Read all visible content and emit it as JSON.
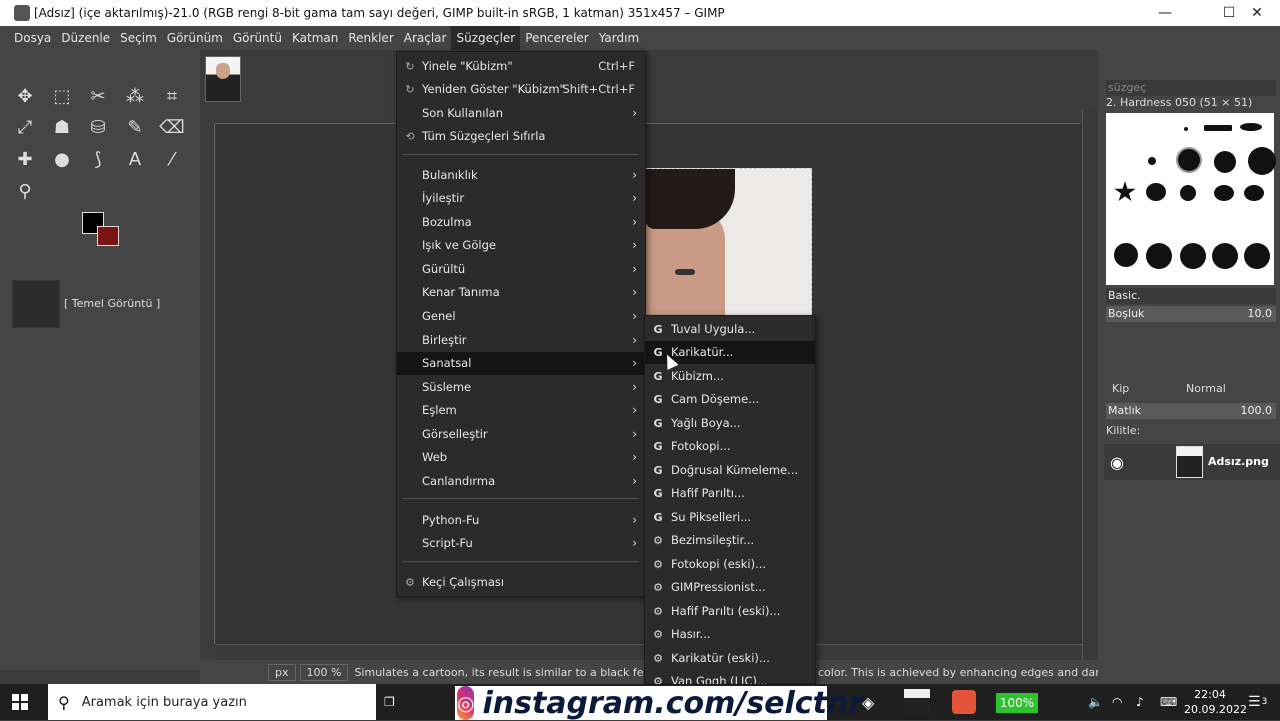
{
  "window": {
    "title": "[Adsız] (içe aktarılmış)-21.0 (RGB rengi 8-bit gama tam sayı değeri, GIMP built-in sRGB, 1 katman) 351x457 – GIMP",
    "minimize": "—",
    "maximize": "☐",
    "close": "✕"
  },
  "menubar": [
    "Dosya",
    "Düzenle",
    "Seçim",
    "Görünüm",
    "Görüntü",
    "Katman",
    "Renkler",
    "Araçlar",
    "Süzgeçler",
    "Pencereler",
    "Yardım"
  ],
  "menubar_active": "Süzgeçler",
  "filters_menu": {
    "items": [
      {
        "label": "Yinele \"Kübizm\"",
        "shortcut": "Ctrl+F",
        "icon": "↻"
      },
      {
        "label": "Yeniden Göster \"Kübizm\"",
        "shortcut": "Shift+Ctrl+F",
        "icon": "↻"
      },
      {
        "label": "Son Kullanılan",
        "arrow": "›"
      },
      {
        "label": "Tüm Süzgeçleri Sıfırla",
        "icon": "⟲"
      },
      {
        "label": "Bulanıklık",
        "arrow": "›"
      },
      {
        "label": "İyileştir",
        "arrow": "›"
      },
      {
        "label": "Bozulma",
        "arrow": "›"
      },
      {
        "label": "Işık ve Gölge",
        "arrow": "›"
      },
      {
        "label": "Gürültü",
        "arrow": "›"
      },
      {
        "label": "Kenar Tanıma",
        "arrow": "›"
      },
      {
        "label": "Genel",
        "arrow": "›"
      },
      {
        "label": "Birleştir",
        "arrow": "›"
      },
      {
        "label": "Sanatsal",
        "arrow": "›"
      },
      {
        "label": "Süsleme",
        "arrow": "›"
      },
      {
        "label": "Eşlem",
        "arrow": "›"
      },
      {
        "label": "Görselleştir",
        "arrow": "›"
      },
      {
        "label": "Web",
        "arrow": "›"
      },
      {
        "label": "Canlandırma",
        "arrow": "›"
      },
      {
        "label": "Python-Fu",
        "arrow": "›"
      },
      {
        "label": "Script-Fu",
        "arrow": "›"
      },
      {
        "label": "Keçi Çalışması",
        "icon": "⚙"
      }
    ]
  },
  "artistic_submenu": {
    "items": [
      {
        "label": "Tuval Uygula...",
        "icon": "G"
      },
      {
        "label": "Karikatür...",
        "icon": "G"
      },
      {
        "label": "Kübizm...",
        "icon": "G"
      },
      {
        "label": "Cam Döşeme...",
        "icon": "G"
      },
      {
        "label": "Yağlı Boya...",
        "icon": "G"
      },
      {
        "label": "Fotokopi...",
        "icon": "G"
      },
      {
        "label": "Doğrusal Kümeleme...",
        "icon": "G"
      },
      {
        "label": "Hafif Parıltı...",
        "icon": "G"
      },
      {
        "label": "Su Pikselleri...",
        "icon": "G"
      },
      {
        "label": "Bezimsileştir...",
        "icon": "⚙"
      },
      {
        "label": "Fotokopi (eski)...",
        "icon": "⚙"
      },
      {
        "label": "GIMPressionist...",
        "icon": "⚙"
      },
      {
        "label": "Hafif Parıltı (eski)...",
        "icon": "⚙"
      },
      {
        "label": "Hasır...",
        "icon": "⚙"
      },
      {
        "label": "Karikatür (eski)...",
        "icon": "⚙"
      },
      {
        "label": "Van Gogh (LIC)...",
        "icon": "⚙"
      }
    ]
  },
  "left_dock": {
    "layer_label": "[ Temel Görüntü ]"
  },
  "right_dock": {
    "filter_placeholder": "süzgeç",
    "brush_name": "2. Hardness 050 (51 × 51)",
    "preset": "Basic.",
    "spacing_label": "Boşluk",
    "spacing_value": "10.0",
    "mode_label": "Kip",
    "mode_value": "Normal",
    "opacity_label": "Matlık",
    "opacity_value": "100.0",
    "lock_label": "Kilitle:",
    "layer_name": "Adsız.png"
  },
  "status": {
    "unit": "px",
    "zoom": "100 %",
    "message": "Simulates a cartoon, its result is similar to a black felt pen c",
    "message_tail": "color. This is achieved by enhancing edges and darke..."
  },
  "taskbar": {
    "search_placeholder": "Aramak için buraya yazın",
    "overlay_text": "instagram.com/selctnr",
    "battery": "100%",
    "time": "22:04",
    "date": "20.09.2022",
    "notifications": "3"
  }
}
